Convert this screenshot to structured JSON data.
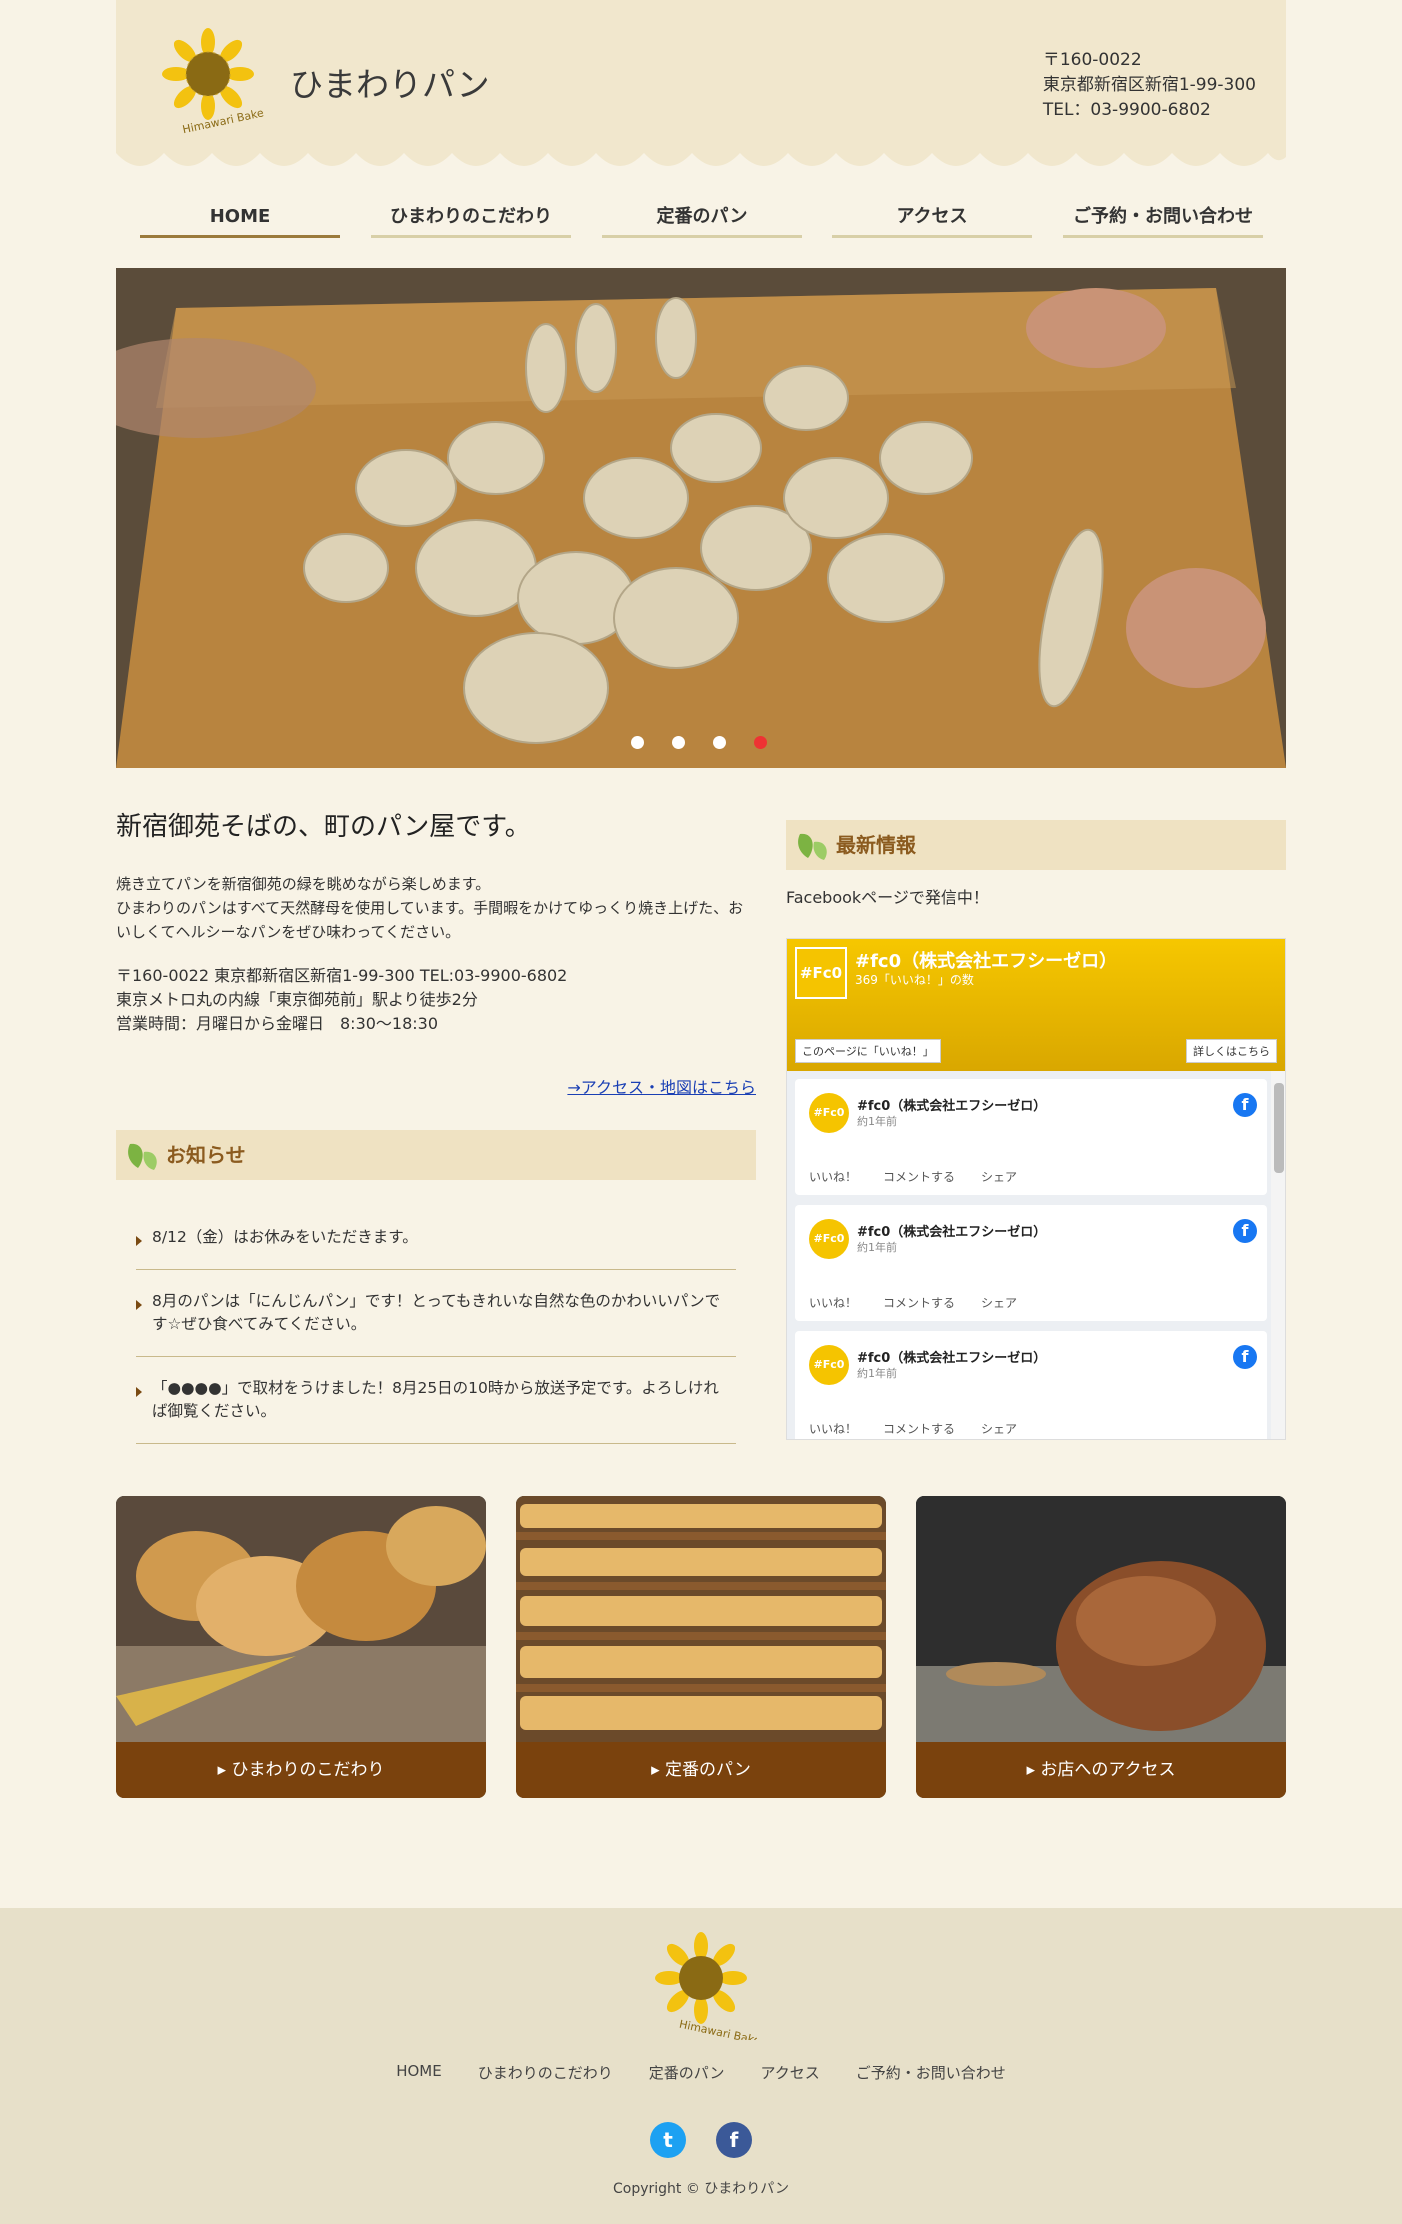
{
  "header": {
    "site_title": "ひまわりパン",
    "logo_text": "Himawari Bakery",
    "postal": "〒160-0022",
    "address": "東京都新宿区新宿1-99-300",
    "tel": "TEL：03-9900-6802"
  },
  "nav": [
    {
      "label": "HOME"
    },
    {
      "label": "ひまわりのこだわり"
    },
    {
      "label": "定番のパン"
    },
    {
      "label": "アクセス"
    },
    {
      "label": "ご予約・お問い合わせ"
    }
  ],
  "hero": {
    "slides": 4,
    "active_slide": 4,
    "image": "bakers-shaping-dough"
  },
  "intro": {
    "heading": "新宿御苑そばの、町のパン屋です。",
    "line1": "焼き立てパンを新宿御苑の緑を眺めながら楽しめます。",
    "line2": "ひまわりのパンはすべて天然酵母を使用しています。手間暇をかけてゆっくり焼き上げた、おいしくてヘルシーなパンをぜひ味わってください。",
    "access1": "〒160-0022 東京都新宿区新宿1-99-300 TEL:03-9900-6802",
    "access2": "東京メトロ丸の内線「東京御苑前」駅より徒歩2分",
    "access3": "営業時間：月曜日から金曜日　8:30〜18:30",
    "map_link": "→アクセス・地図はこちら"
  },
  "news": {
    "heading": "お知らせ",
    "items": [
      {
        "text": "8/12（金）はお休みをいただきます。"
      },
      {
        "text": "8月のパンは「にんじんパン」です！とってもきれいな自然な色のかわいいパンです☆ぜひ食べてみてください。"
      },
      {
        "text": "「●●●●」で取材をうけました！8月25日の10時から放送予定です。よろしければ御覧ください。"
      }
    ]
  },
  "latest": {
    "heading": "最新情報",
    "note": "Facebookページで発信中！"
  },
  "facebook": {
    "page_name": "#fc0（株式会社エフシーゼロ）",
    "likes": "369「いいね！」の数",
    "logo": "#Fc0",
    "like_button": "このページに「いいね！」",
    "more_button": "詳しくはこちら",
    "posts": [
      {
        "name": "#fc0（株式会社エフシーゼロ）",
        "time": "約1年前",
        "like": "いいね！",
        "comment": "コメントする",
        "share": "シェア"
      },
      {
        "name": "#fc0（株式会社エフシーゼロ）",
        "time": "約1年前",
        "like": "いいね！",
        "comment": "コメントする",
        "share": "シェア"
      },
      {
        "name": "#fc0（株式会社エフシーゼロ）",
        "time": "約1年前",
        "like": "いいね！",
        "comment": "コメントする",
        "share": "シェア"
      }
    ]
  },
  "cards": [
    {
      "label": "ひまわりのこだわり",
      "image": "braided-breads-and-wheat"
    },
    {
      "label": "定番のパン",
      "image": "shelves-of-loaves"
    },
    {
      "label": "お店へのアクセス",
      "image": "rustic-round-loaf"
    }
  ],
  "footer": {
    "logo_text": "Himawari Bakery",
    "nav": [
      "HOME",
      "ひまわりのこだわり",
      "定番のパン",
      "アクセス",
      "ご予約・お問い合わせ"
    ],
    "social": [
      "twitter-icon",
      "facebook-icon"
    ],
    "copyright": "Copyright © ひまわりパン"
  },
  "colors": {
    "background": "#f8f3e6",
    "header": "#f1e7cd",
    "accent_brown": "#7a420d",
    "heading_bar": "#efe2c2",
    "twitter": "#1da1f2",
    "facebook": "#3b5998"
  }
}
